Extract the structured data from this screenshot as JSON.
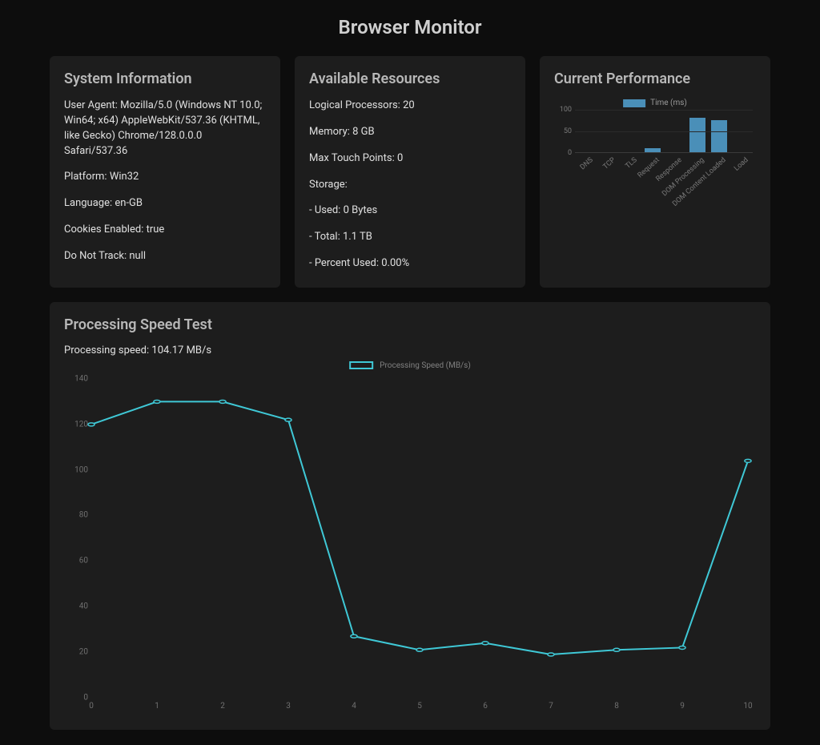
{
  "page": {
    "title": "Browser Monitor"
  },
  "system_info": {
    "title": "System Information",
    "user_agent_label": "User Agent:",
    "user_agent": "Mozilla/5.0 (Windows NT 10.0; Win64; x64) AppleWebKit/537.36 (KHTML, like Gecko) Chrome/128.0.0.0 Safari/537.36",
    "platform_label": "Platform:",
    "platform": "Win32",
    "language_label": "Language:",
    "language": "en-GB",
    "cookies_label": "Cookies Enabled:",
    "cookies": "true",
    "dnt_label": "Do Not Track:",
    "dnt": "null"
  },
  "resources": {
    "title": "Available Resources",
    "logical_label": "Logical Processors:",
    "logical": "20",
    "memory_label": "Memory:",
    "memory": "8 GB",
    "touch_label": "Max Touch Points:",
    "touch": "0",
    "storage_label": "Storage:",
    "storage_used_label": "- Used:",
    "storage_used": "0 Bytes",
    "storage_total_label": "- Total:",
    "storage_total": "1.1 TB",
    "storage_pct_label": "- Percent Used:",
    "storage_pct": "0.00%"
  },
  "performance": {
    "title": "Current Performance",
    "legend": "Time (ms)"
  },
  "speed": {
    "title": "Processing Speed Test",
    "status_label": "Processing speed:",
    "status_value": "104.17 MB/s",
    "legend": "Processing Speed (MB/s)"
  },
  "chart_data": [
    {
      "type": "bar",
      "title": "Current Performance",
      "ylabel": "Time (ms)",
      "ylim": [
        0,
        100
      ],
      "yticks": [
        0,
        50,
        100
      ],
      "categories": [
        "DNS",
        "TCP",
        "TLS",
        "Request",
        "Response",
        "DOM Processing",
        "DOM Content Loaded",
        "Load"
      ],
      "values": [
        0,
        0,
        0,
        10,
        0,
        80,
        75,
        0
      ],
      "color": "#4a8fb8"
    },
    {
      "type": "line",
      "title": "Processing Speed Test",
      "ylabel": "Processing Speed (MB/s)",
      "xlim": [
        0,
        10
      ],
      "ylim": [
        0,
        140
      ],
      "yticks": [
        0,
        20,
        40,
        60,
        80,
        100,
        120,
        140
      ],
      "xticks": [
        0,
        1,
        2,
        3,
        4,
        5,
        6,
        7,
        8,
        9,
        10
      ],
      "x": [
        0,
        1,
        2,
        3,
        4,
        5,
        6,
        7,
        8,
        9,
        10
      ],
      "y": [
        120,
        130,
        130,
        122,
        27,
        21,
        24,
        19,
        21,
        22,
        104
      ],
      "color": "#3fc8d6"
    }
  ]
}
